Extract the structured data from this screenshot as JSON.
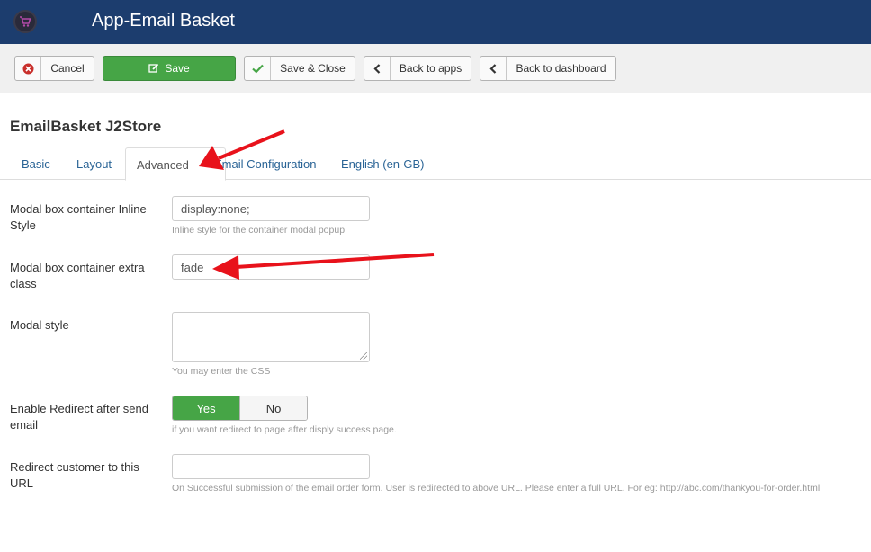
{
  "header": {
    "title": "App-Email Basket",
    "logo_icon": "cart-logo-icon"
  },
  "toolbar": {
    "cancel_label": "Cancel",
    "save_label": "Save",
    "save_close_label": "Save & Close",
    "back_apps_label": "Back to apps",
    "back_dashboard_label": "Back to dashboard"
  },
  "page": {
    "title": "EmailBasket J2Store"
  },
  "tabs": [
    {
      "label": "Basic"
    },
    {
      "label": "Layout"
    },
    {
      "label": "Advanced"
    },
    {
      "label": "Email Configuration"
    },
    {
      "label": "English (en-GB)"
    }
  ],
  "form": {
    "modal_inline_style": {
      "label": "Modal box container Inline Style",
      "value": "display:none;",
      "help": "Inline style for the container modal popup"
    },
    "modal_extra_class": {
      "label": "Modal box container extra class",
      "value": "fade"
    },
    "modal_style": {
      "label": "Modal style",
      "value": "",
      "help": "You may enter the CSS"
    },
    "enable_redirect": {
      "label": "Enable Redirect after send email",
      "yes": "Yes",
      "no": "No",
      "selected": "Yes",
      "help": "if you want redirect to page after disply success page."
    },
    "redirect_url": {
      "label": "Redirect customer to this URL",
      "value": "",
      "help": "On Successful submission of the email order form. User is redirected to above URL. Please enter a full URL. For eg: http://abc.com/thankyou-for-order.html"
    }
  },
  "colors": {
    "header": "#1c3d6e",
    "save": "#46a546",
    "annotation_arrow": "#e8121b",
    "link": "#2a6496"
  }
}
